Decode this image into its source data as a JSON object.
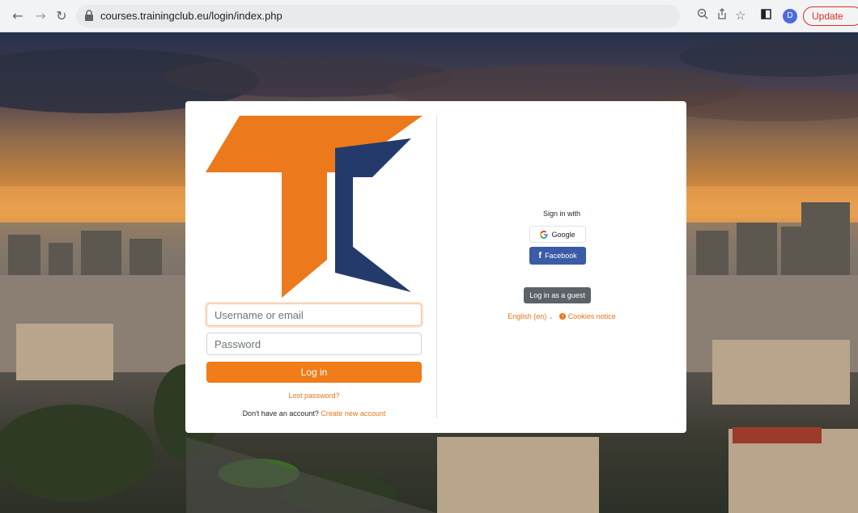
{
  "browser": {
    "url": "courses.trainingclub.eu/login/index.php",
    "profile_initial": "D",
    "update_label": "Update",
    "icons": [
      "back-arrow-icon",
      "forward-arrow-icon",
      "reload-icon",
      "lock-icon",
      "zoom-icon",
      "share-icon",
      "bookmark-star-icon",
      "side-panel-icon",
      "menu-dots-icon"
    ]
  },
  "login": {
    "username_placeholder": "Username or email",
    "password_placeholder": "Password",
    "login_label": "Log in",
    "lost_password": "Lost password?",
    "no_account_text": "Don't have an account?",
    "create_account": "Create new account"
  },
  "sso": {
    "title": "Sign in with",
    "google_label": "Google",
    "facebook_label": "Facebook"
  },
  "guest_label": "Log in as a guest",
  "language": "English (en)",
  "cookies_notice": "Cookies notice",
  "colors": {
    "accent": "#f07c1a",
    "logo_orange": "#ec7a1c",
    "logo_navy": "#233a6b",
    "facebook": "#3b5ba7",
    "guest_button": "#5c6268"
  }
}
